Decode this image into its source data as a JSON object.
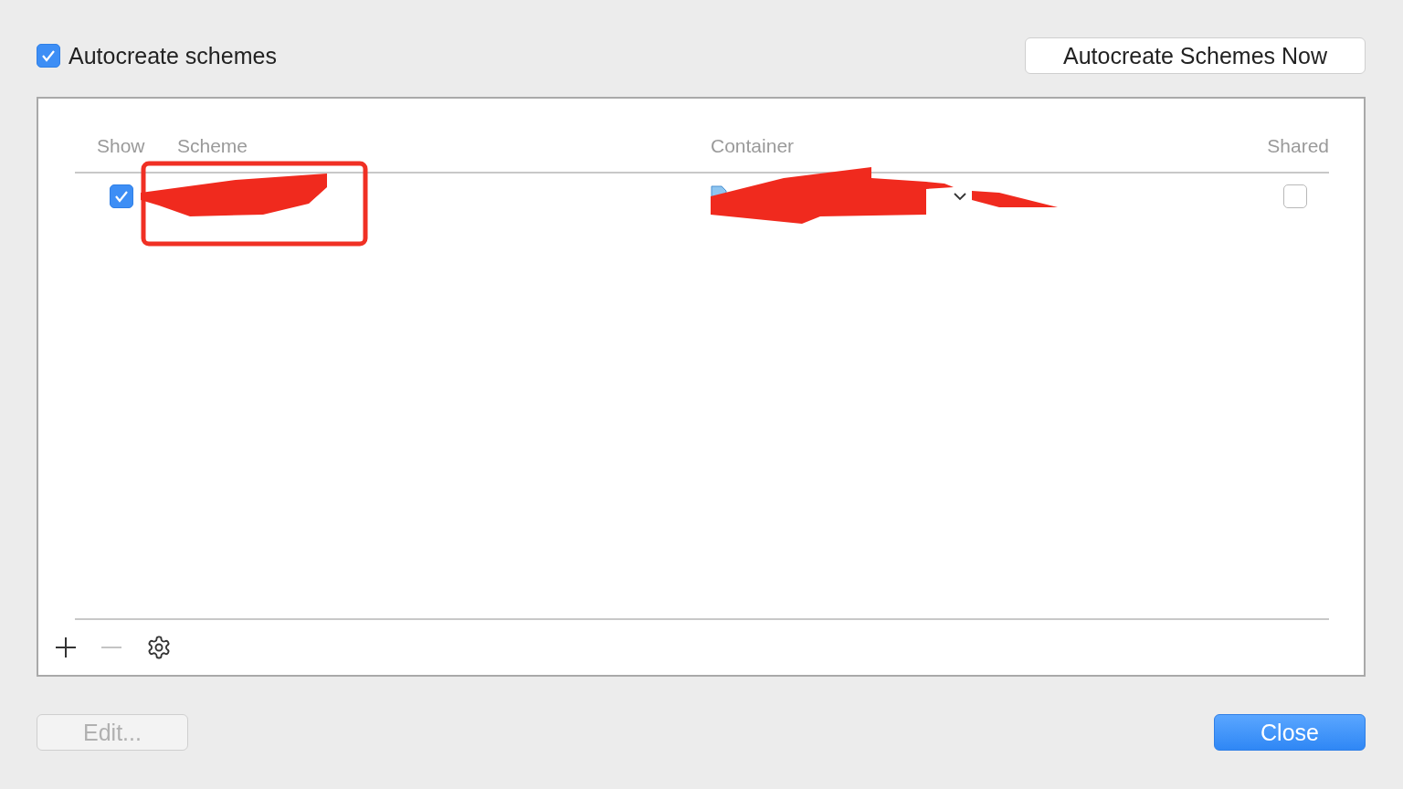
{
  "autocreate": {
    "label": "Autocreate schemes",
    "checked": true
  },
  "autocreate_now_button": "Autocreate Schemes Now",
  "table": {
    "columns": [
      "Show",
      "Scheme",
      "Container",
      "Shared"
    ],
    "rows": [
      {
        "show": true,
        "shared": false
      }
    ]
  },
  "toolbar": [
    {
      "kind": "add",
      "disabled": false
    },
    {
      "kind": "remove",
      "disabled": true
    },
    {
      "kind": "settings",
      "disabled": false
    }
  ],
  "buttons": [
    {
      "label": "Edit...",
      "kind": "secondary",
      "disabled": true
    },
    {
      "label": "Close",
      "kind": "primary",
      "disabled": false
    }
  ]
}
